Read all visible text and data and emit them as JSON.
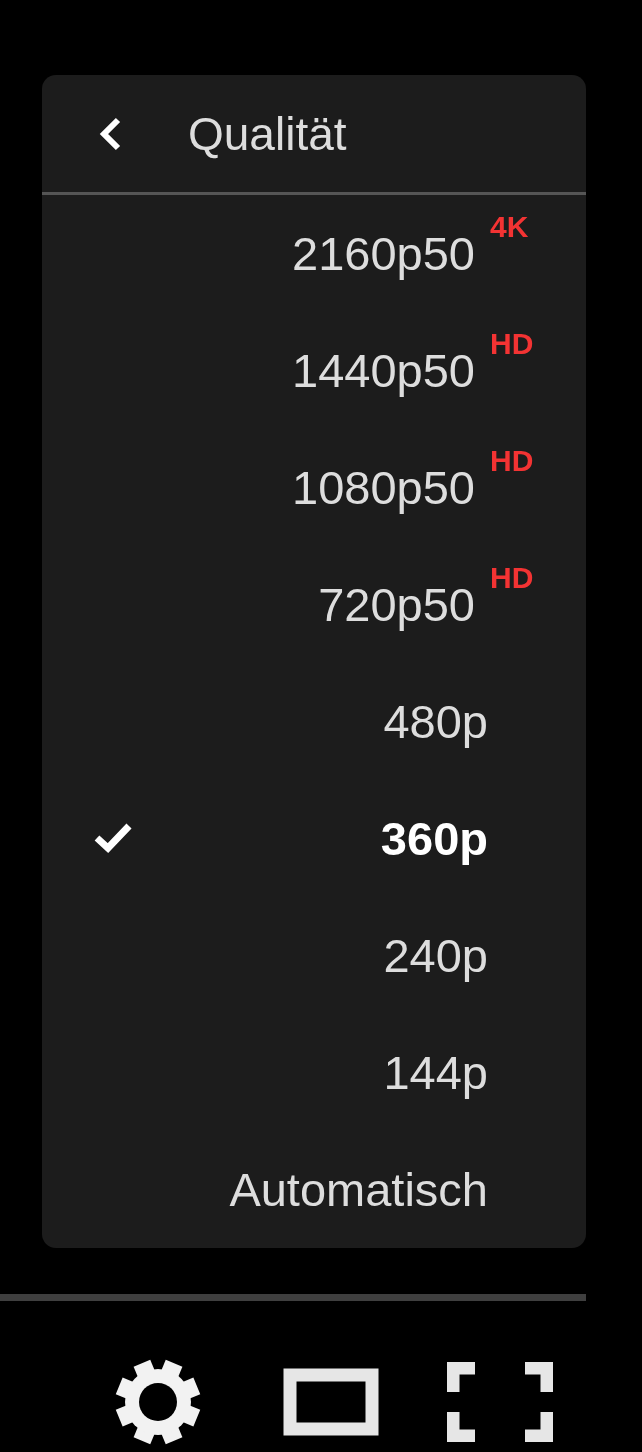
{
  "menu": {
    "title": "Qualität",
    "items": [
      {
        "label": "2160p50",
        "badge": "4K",
        "selected": false
      },
      {
        "label": "1440p50",
        "badge": "HD",
        "selected": false
      },
      {
        "label": "1080p50",
        "badge": "HD",
        "selected": false
      },
      {
        "label": "720p50",
        "badge": "HD",
        "selected": false
      },
      {
        "label": "480p",
        "selected": false
      },
      {
        "label": "360p",
        "selected": true
      },
      {
        "label": "240p",
        "selected": false
      },
      {
        "label": "144p",
        "selected": false
      },
      {
        "label": "Automatisch",
        "selected": false
      }
    ]
  },
  "controls": [
    {
      "kind": "settings"
    },
    {
      "kind": "theater"
    },
    {
      "kind": "fullscreen"
    }
  ]
}
